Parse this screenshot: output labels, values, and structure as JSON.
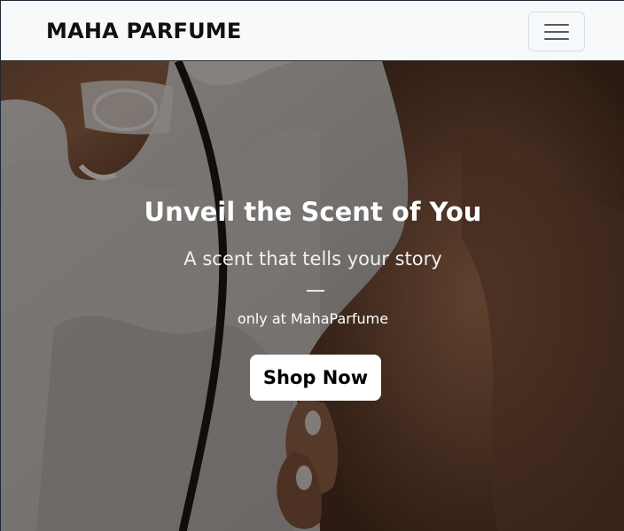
{
  "navbar": {
    "brand": "MAHA PARFUME",
    "menu_icon": "hamburger-menu-icon"
  },
  "hero": {
    "title": "Unveil the Scent of You",
    "subtitle": "A scent that tells your story",
    "note": "only at MahaParfume",
    "cta_label": "Shop Now"
  },
  "colors": {
    "navbar_bg": "#f8f9fa",
    "text_dark": "#111111",
    "hero_text": "#ffffff",
    "button_bg": "#ffffff"
  }
}
